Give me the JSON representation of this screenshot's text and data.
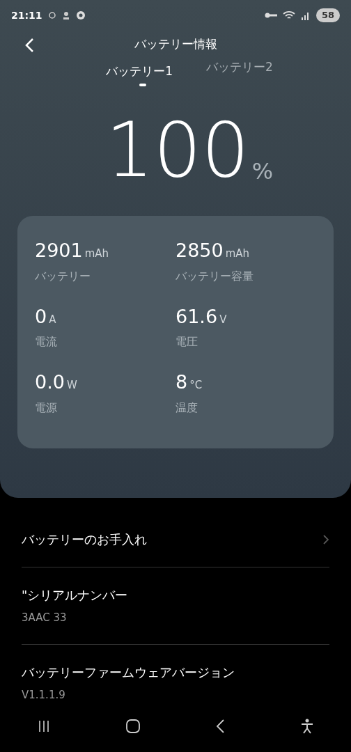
{
  "status_bar": {
    "time": "21:11",
    "battery": "58"
  },
  "title": "バッテリー情報",
  "tabs": [
    {
      "label": "バッテリー1",
      "selected": true
    },
    {
      "label": "バッテリー2",
      "selected": false
    }
  ],
  "percent": {
    "value": "100",
    "unit": "%"
  },
  "stats": [
    {
      "value": "2901",
      "unit": "mAh",
      "label": "バッテリー"
    },
    {
      "value": "2850",
      "unit": "mAh",
      "label": "バッテリー容量"
    },
    {
      "value": "0",
      "unit": "A",
      "label": "電流"
    },
    {
      "value": "61.6",
      "unit": "V",
      "label": "電圧"
    },
    {
      "value": "0.0",
      "unit": "W",
      "label": "電源"
    },
    {
      "value": "8",
      "unit": "°C",
      "label": "温度"
    }
  ],
  "items": [
    {
      "kind": "link",
      "title": "バッテリーのお手入れ"
    },
    {
      "kind": "info",
      "title": "\"シリアルナンバー",
      "value": "3AAC 33"
    },
    {
      "kind": "info",
      "title": "バッテリーファームウェアバージョン",
      "value": "V1.1.1.9"
    }
  ]
}
